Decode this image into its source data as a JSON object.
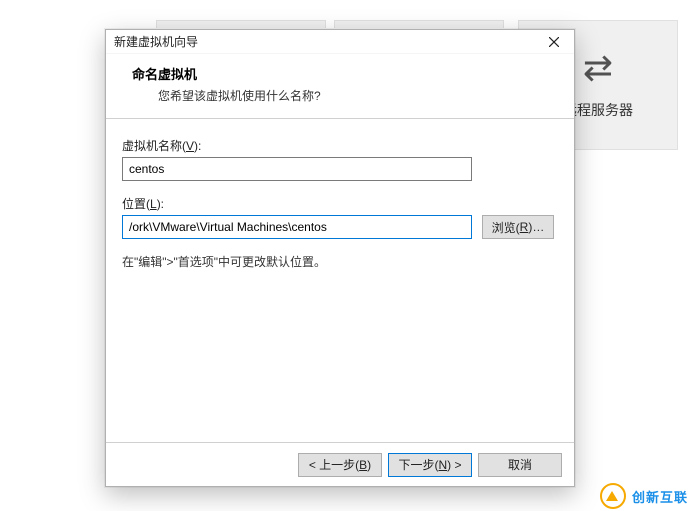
{
  "background": {
    "remote_server_label": "远程服务器"
  },
  "dialog": {
    "title": "新建虚拟机向导",
    "header_title": "命名虚拟机",
    "header_subtitle": "您希望该虚拟机使用什么名称?",
    "name_label_prefix": "虚拟机名称(",
    "name_label_mn": "V",
    "name_label_suffix": "):",
    "name_value": "centos",
    "location_label_prefix": "位置(",
    "location_label_mn": "L",
    "location_label_suffix": "):",
    "location_value": "/ork\\VMware\\Virtual Machines\\centos",
    "browse_prefix": "浏览(",
    "browse_mn": "R",
    "browse_suffix": ")…",
    "hint": "在\"编辑\">\"首选项\"中可更改默认位置。",
    "back_prefix": "< 上一步(",
    "back_mn": "B",
    "back_suffix": ")",
    "next_prefix": "下一步(",
    "next_mn": "N",
    "next_suffix": ") >",
    "cancel": "取消"
  },
  "brand": {
    "text": "创新互联"
  }
}
